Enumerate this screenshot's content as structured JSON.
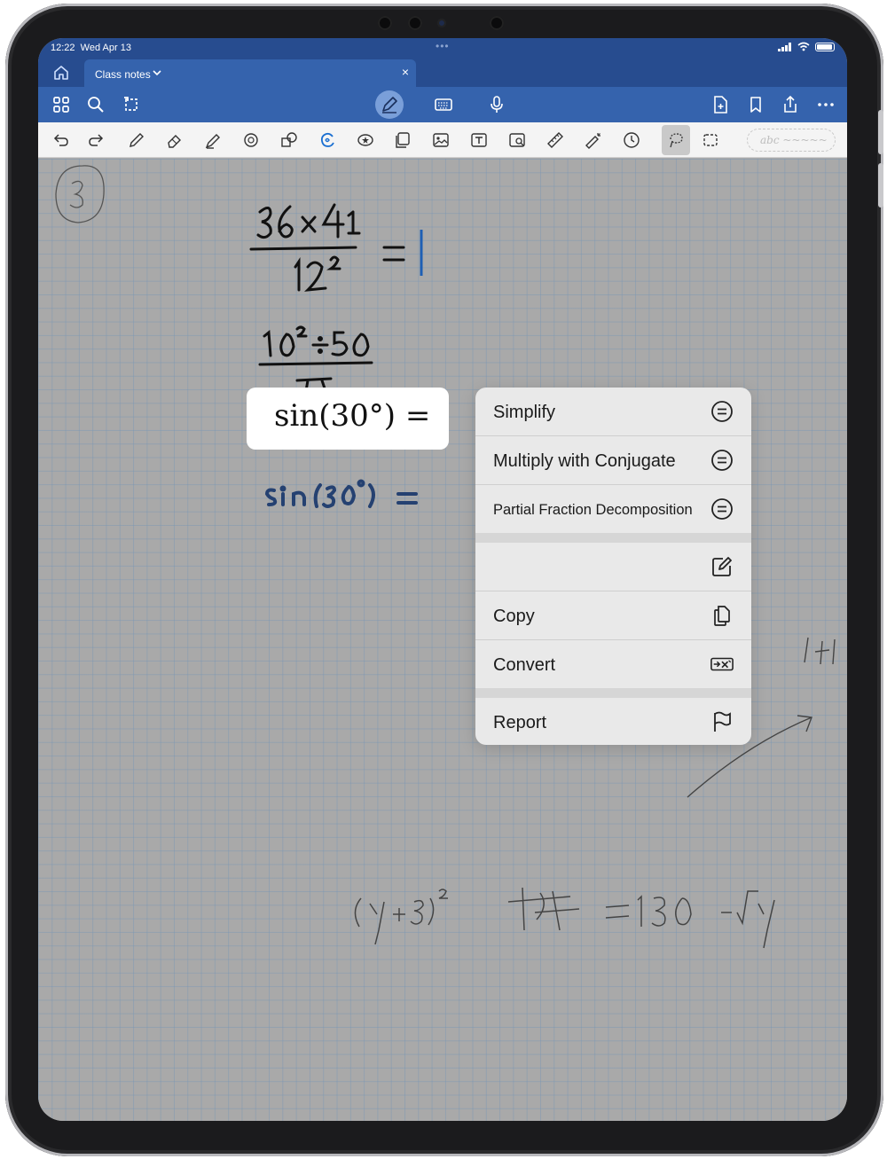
{
  "status": {
    "time": "12:22",
    "date": "Wed Apr 13"
  },
  "tab": {
    "title": "Class notes",
    "close": "×"
  },
  "toolbar": {
    "handwriting_placeholder": "abc ~~~~~"
  },
  "math_preview": {
    "expression": "sin(30°) ="
  },
  "context_menu": {
    "items": [
      {
        "label": "Simplify",
        "icon": "equals-circle-icon"
      },
      {
        "label": "Multiply with Conjugate",
        "icon": "equals-circle-icon"
      },
      {
        "label": "Partial Fraction Decomposition",
        "icon": "equals-circle-icon"
      },
      {
        "label": "",
        "icon": "edit-icon"
      },
      {
        "label": "Copy",
        "icon": "copy-icon"
      },
      {
        "label": "Convert",
        "icon": "convert-math-icon"
      },
      {
        "label": "Report",
        "icon": "flag-icon"
      }
    ]
  },
  "colors": {
    "app_bar": "#274c8f",
    "toolbar": "#3563ad",
    "ink_blue": "#1e5fb4",
    "page_bg": "#a9a9a9"
  }
}
